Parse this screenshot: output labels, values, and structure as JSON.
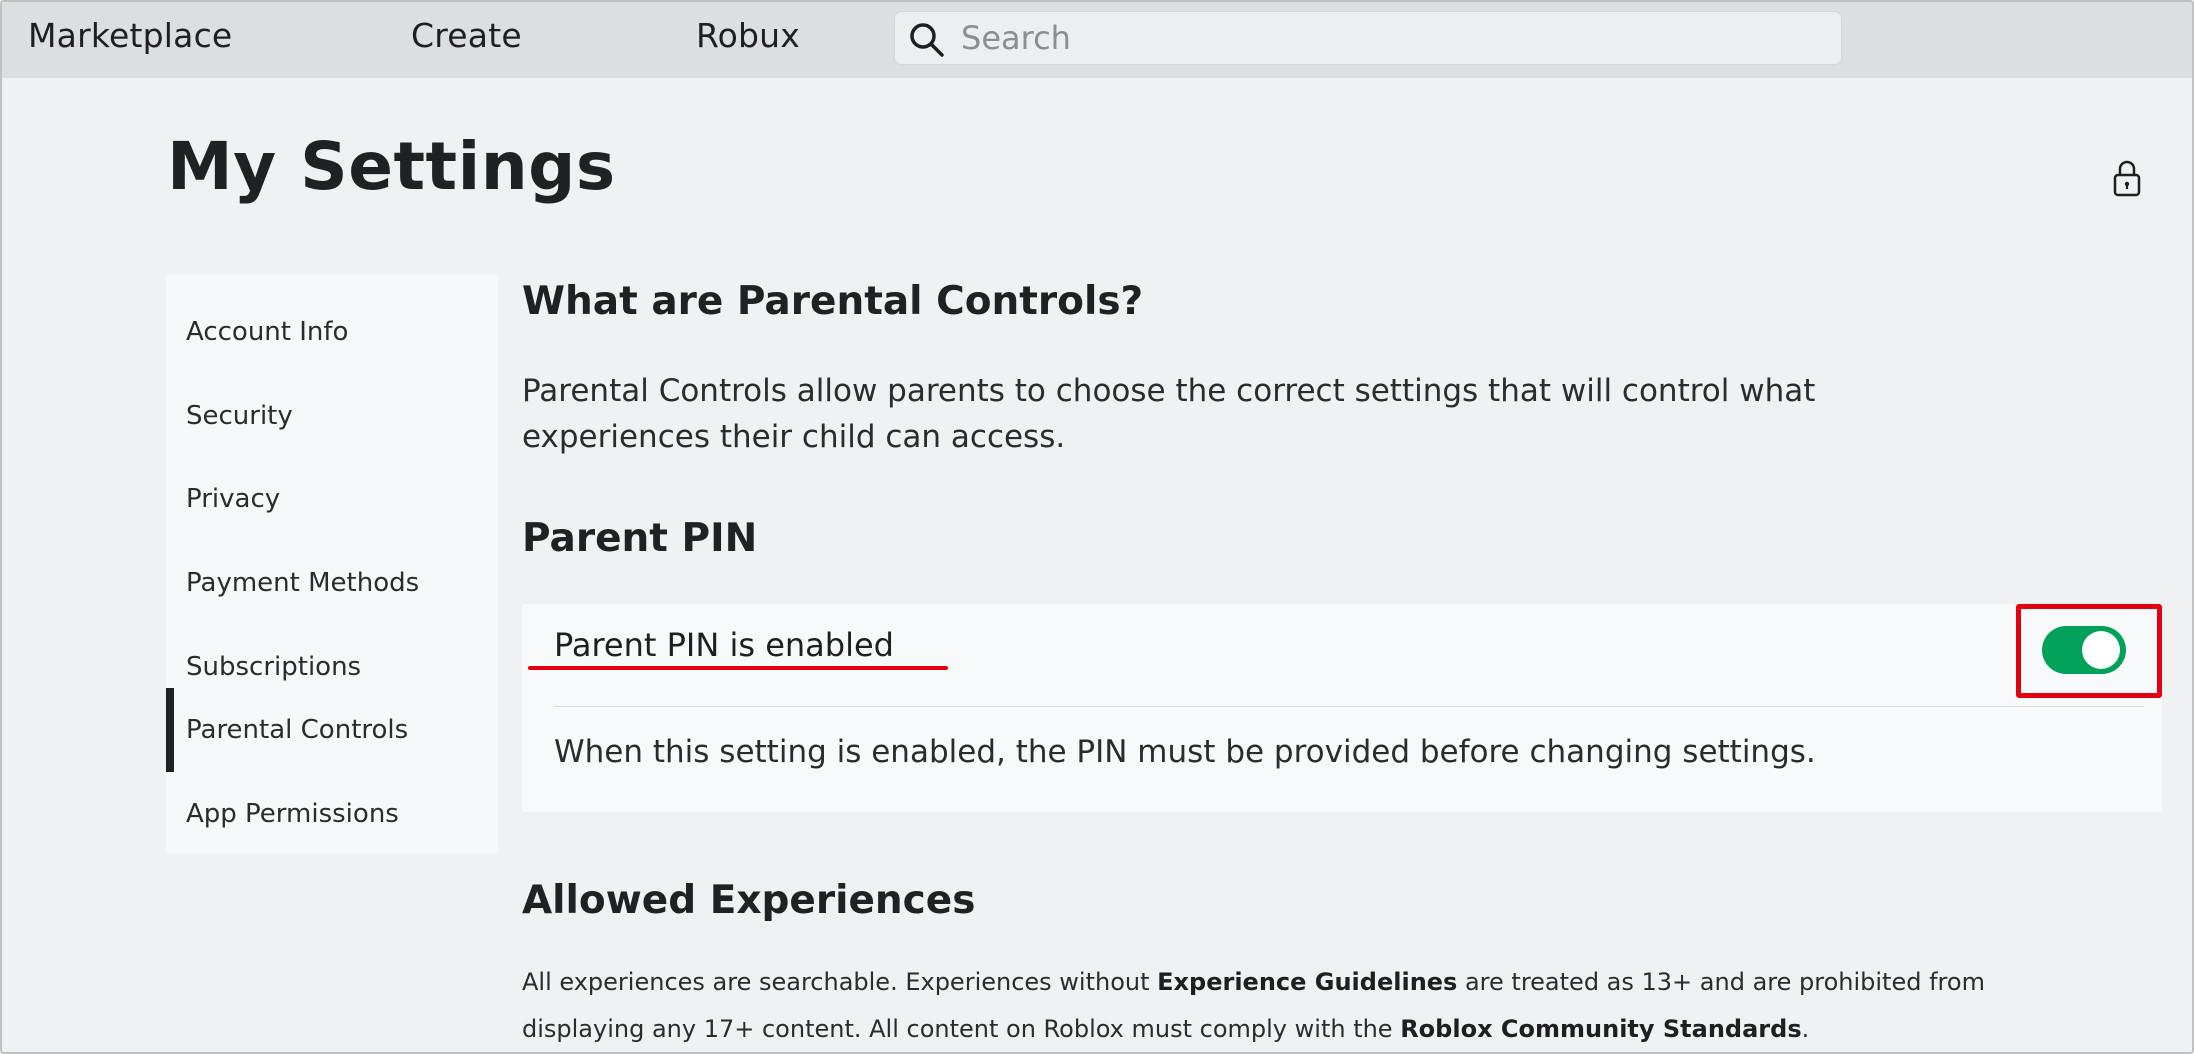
{
  "topnav": {
    "links": [
      "Marketplace",
      "Create",
      "Robux"
    ],
    "search_placeholder": "Search"
  },
  "page_title": "My Settings",
  "sidebar": {
    "items": [
      {
        "label": "Account Info"
      },
      {
        "label": "Security"
      },
      {
        "label": "Privacy"
      },
      {
        "label": "Payment Methods"
      },
      {
        "label": "Subscriptions"
      },
      {
        "label": "Parental Controls",
        "active": true
      },
      {
        "label": "App Permissions"
      }
    ]
  },
  "content": {
    "what_heading": "What are Parental Controls?",
    "what_text_line1": "Parental Controls allow parents to choose the correct settings that will control what",
    "what_text_line2": "experiences their child can access.",
    "pin_heading": "Parent PIN",
    "pin_label": "Parent PIN is enabled",
    "pin_toggle_on": true,
    "pin_description": "When this setting is enabled, the PIN must be provided before changing settings.",
    "allowed_heading": "Allowed Experiences",
    "allowed_text_1a": "All experiences are searchable. Experiences without ",
    "allowed_link_1": "Experience Guidelines",
    "allowed_text_1b": " are treated as 13+ and are prohibited from",
    "allowed_text_2a": "displaying any 17+ content. All content on Roblox must comply with the ",
    "allowed_link_2": "Roblox Community Standards",
    "allowed_text_2b": "."
  },
  "colors": {
    "toggle_on": "#00a158",
    "highlight_red": "#e3000f"
  }
}
